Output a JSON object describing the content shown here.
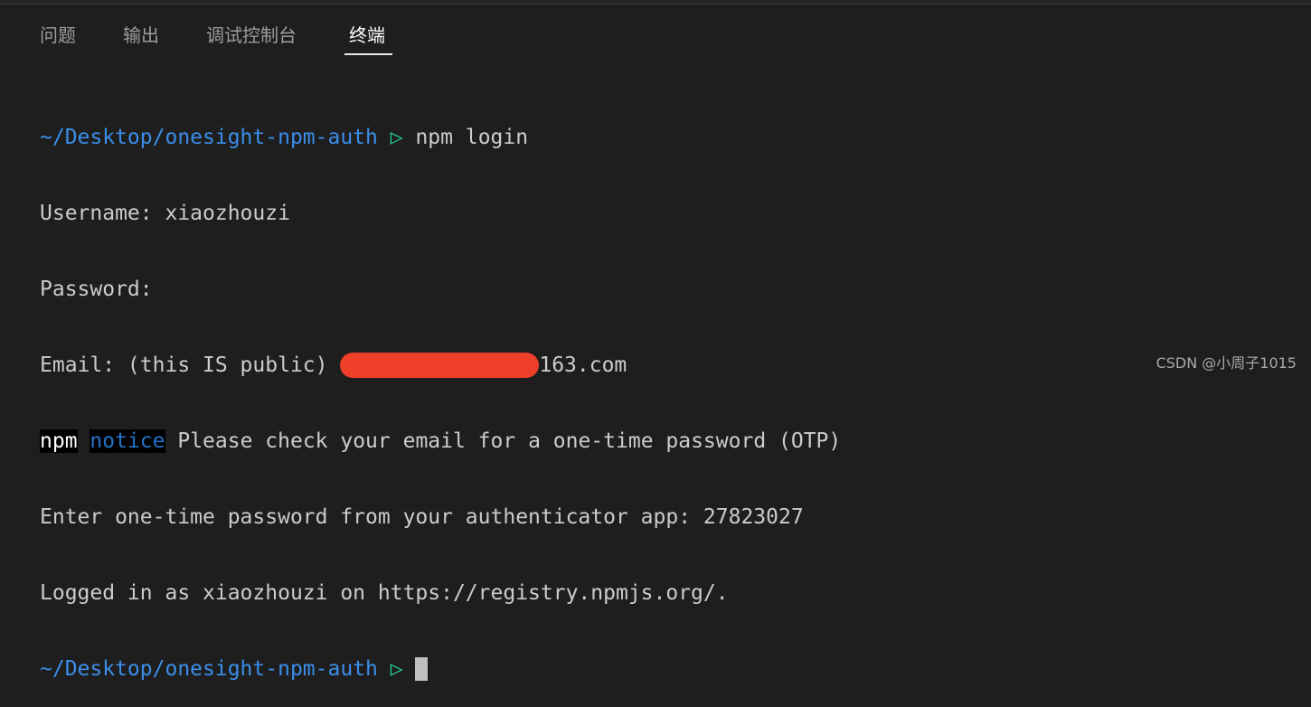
{
  "panel": {
    "tabs": [
      {
        "label": "问题",
        "active": false
      },
      {
        "label": "输出",
        "active": false
      },
      {
        "label": "调试控制台",
        "active": false
      },
      {
        "label": "终端",
        "active": true
      }
    ]
  },
  "terminal": {
    "prompt_path": "~/Desktop/onesight-npm-auth",
    "prompt_symbol": "▷",
    "command": "npm login",
    "username_line": "Username: xiaozhouzi",
    "password_line": "Password:",
    "email_prefix": "Email: (this IS public) ",
    "email_suffix": "163.com",
    "notice_npm": "npm",
    "notice_tag": "notice",
    "notice_text": " Please check your email for a one-time password (OTP)",
    "otp_line": "Enter one-time password from your authenticator app: 27823027",
    "logged_line": "Logged in as xiaozhouzi on https://registry.npmjs.org/."
  },
  "watermark": "CSDN @小周子1015",
  "colors": {
    "background": "#1e1e1e",
    "path": "#3b8eea",
    "prompt_arrow": "#23d18b",
    "redaction": "#ee3f29"
  }
}
